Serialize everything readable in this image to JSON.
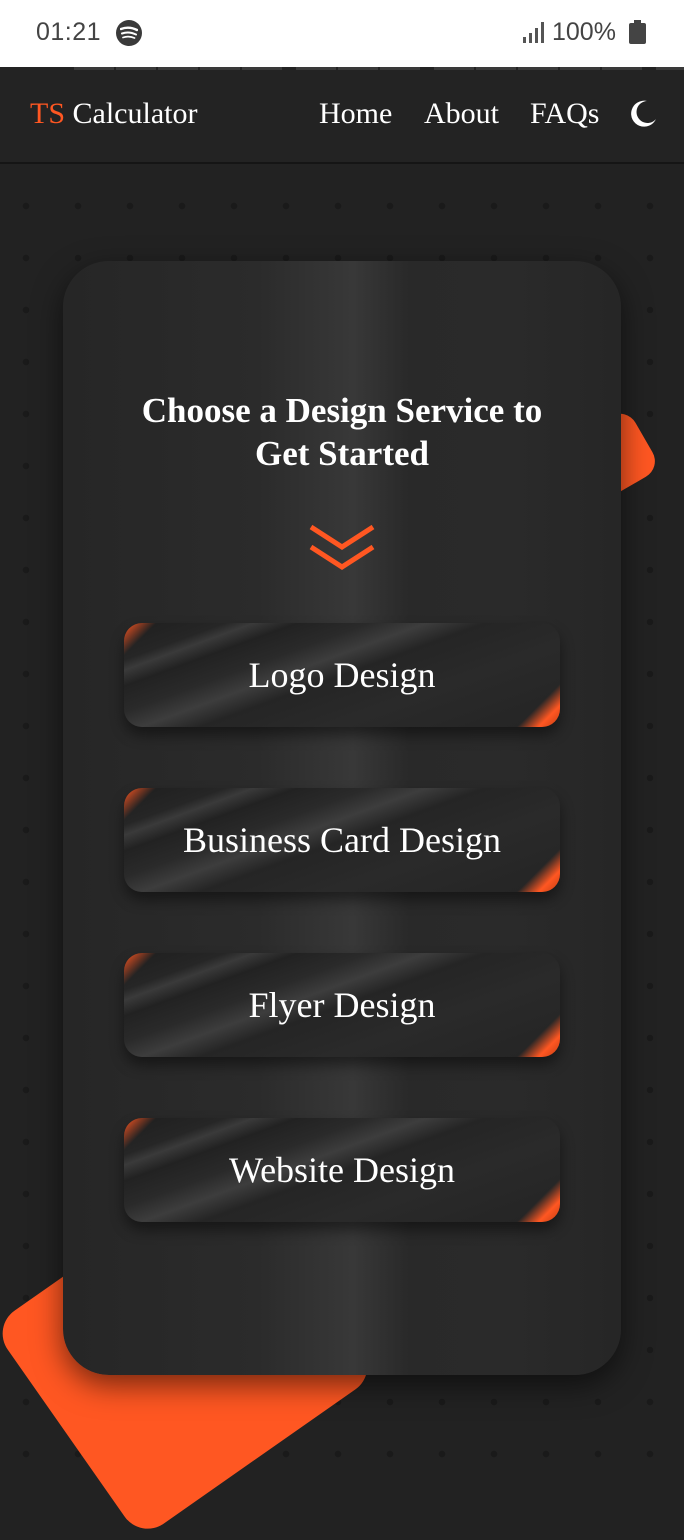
{
  "status_bar": {
    "time": "01:21",
    "battery": "100%",
    "icons": [
      "spotify-icon",
      "signal-icon",
      "battery-icon"
    ]
  },
  "navbar": {
    "brand_prefix": "TS",
    "brand_suffix": " Calculator",
    "links": [
      "Home",
      "About",
      "FAQs"
    ],
    "theme_toggle_icon": "moon-icon"
  },
  "card": {
    "title_line1": "Choose a Design Service to",
    "title_line2": "Get Started",
    "scroll_icon": "double-chevron-down-icon",
    "services": [
      "Logo Design",
      "Business Card Design",
      "Flyer Design",
      "Website Design"
    ]
  },
  "colors": {
    "accent": "#ff5722",
    "background": "#222222",
    "text": "#ffffff"
  }
}
